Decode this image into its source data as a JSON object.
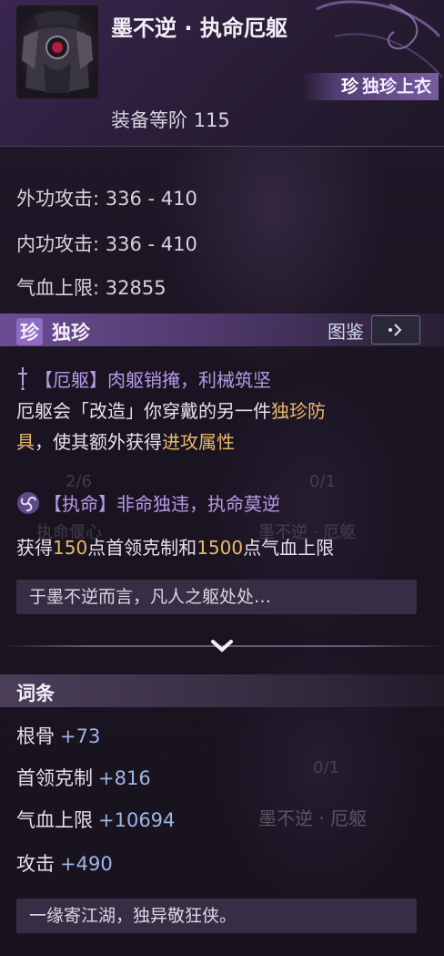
{
  "item": {
    "name": "墨不逆 · 执命厄躯",
    "rarity_gem": "珍",
    "rarity_tag": "独珍上衣",
    "level_label": "装备等阶",
    "level_value": "115"
  },
  "stats": [
    {
      "label": "外功攻击: ",
      "value": "336 - 410"
    },
    {
      "label": "内功攻击: ",
      "value": "336 - 410"
    },
    {
      "label": "气血上限: ",
      "value": "32855"
    }
  ],
  "section_unique": {
    "gem": "珍",
    "title": "独珍",
    "atlas_label": "图鉴"
  },
  "effects": {
    "e1_title": "【厄躯】肉躯销掩，利械筑坚",
    "e1_desc_a": "厄躯会「改造」你穿戴的另一件",
    "e1_desc_hl1": "独珍防",
    "e1_desc_hl1b": "具",
    "e1_desc_b": "，使其额外获得",
    "e1_desc_hl2": "进攻属性",
    "e2_title": "【执命】非命独违，执命莫逆",
    "e2_a": "获得",
    "e2_v1": "150",
    "e2_b": "点首领克制和",
    "e2_v2": "1500",
    "e2_c": "点气血上限"
  },
  "quote1": "于墨不逆而言，凡人之躯处处…",
  "section_affix": {
    "title": "词条"
  },
  "affixes": [
    {
      "label": "根骨",
      "value": "+73"
    },
    {
      "label": "首领克制",
      "value": "+816"
    },
    {
      "label": "气血上限",
      "value": "+10694"
    },
    {
      "label": "攻击",
      "value": "+490"
    }
  ],
  "quote2": "一缘寄江湖，独异敬狂侠。",
  "background_ghosts": {
    "g1": "2/6",
    "g2": "0/1",
    "g3": "执命偃心",
    "g4": "墨不逆 · 厄躯",
    "g5": "0/1",
    "g6": "墨不逆 · 厄躯"
  },
  "colors": {
    "accent_purple": "#b79ae6",
    "highlight_gold": "#e9b86a",
    "affix_value": "#9cb6e6"
  }
}
